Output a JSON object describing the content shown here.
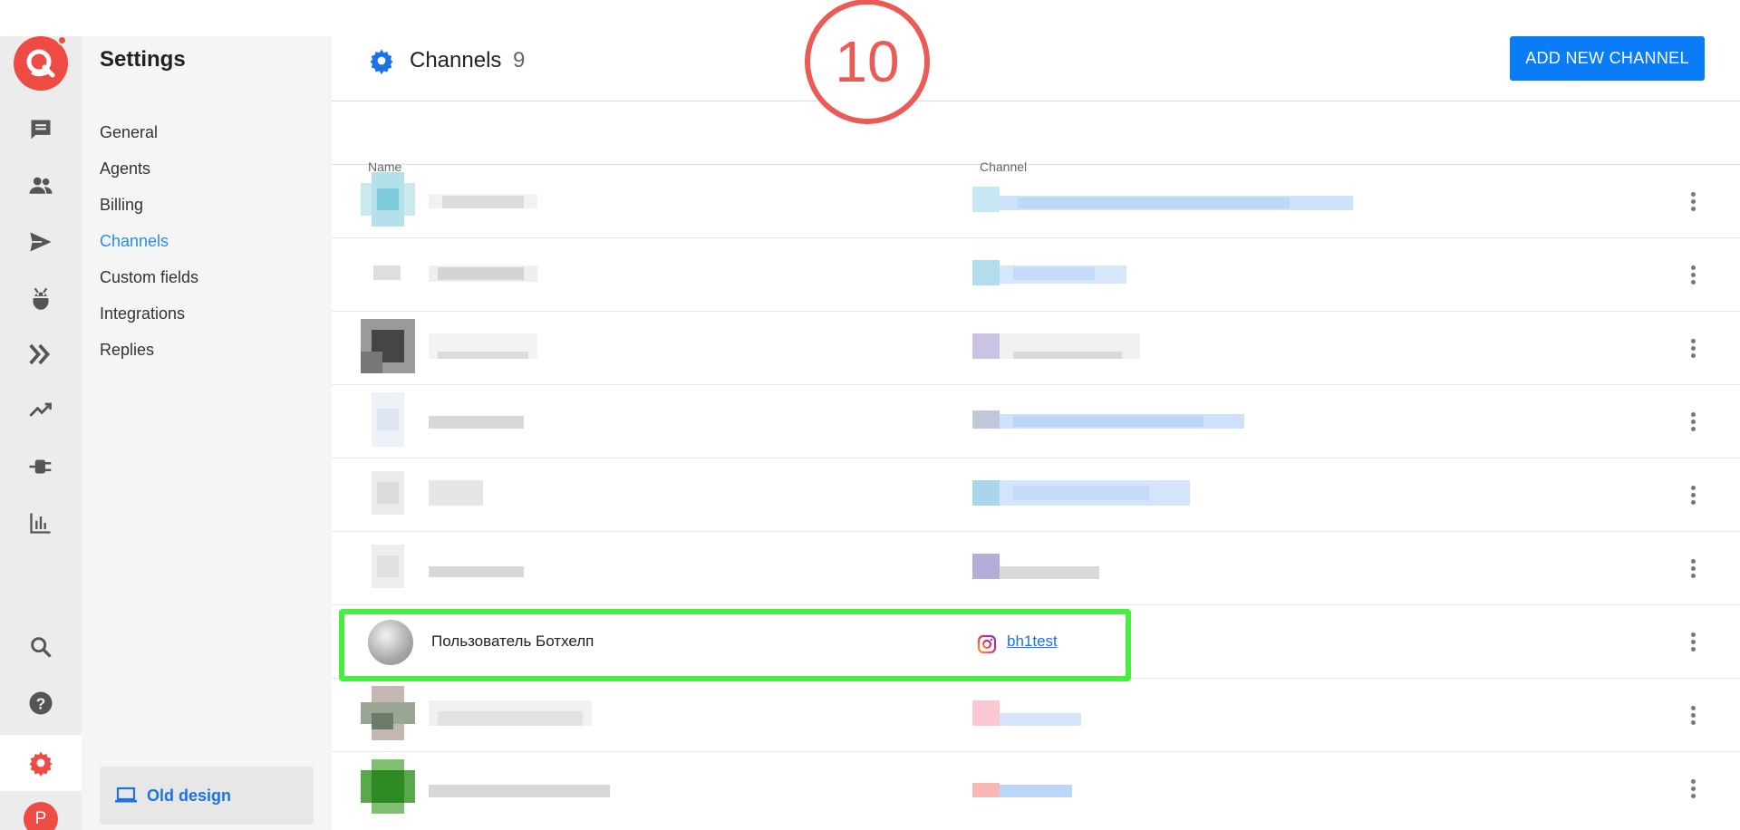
{
  "sidebar": {
    "title": "Settings",
    "items": [
      "General",
      "Agents",
      "Billing",
      "Channels",
      "Custom fields",
      "Integrations",
      "Replies"
    ],
    "active_index": 3,
    "old_design_label": "Old design"
  },
  "header": {
    "title": "Channels",
    "count": "9",
    "add_button": "ADD NEW CHANNEL"
  },
  "table": {
    "columns": [
      "Name",
      "Channel"
    ],
    "highlighted_row": {
      "name": "Пользователь Ботхелп",
      "channel": "bh1test",
      "channel_icon": "instagram-icon"
    }
  },
  "step_marker": "10",
  "colors": {
    "brand": "#ef4b45",
    "accent": "#0a7cf5",
    "highlight": "#45ee3f",
    "step": "#ec5a55"
  }
}
